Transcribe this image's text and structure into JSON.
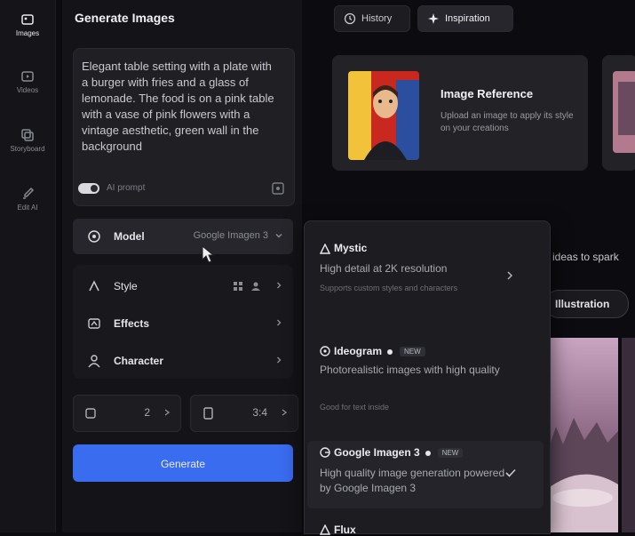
{
  "rail": {
    "items": [
      {
        "label": "Images",
        "icon": "image-icon",
        "active": true
      },
      {
        "label": "Videos",
        "icon": "video-icon"
      },
      {
        "label": "Storyboard",
        "icon": "storyboard-icon"
      },
      {
        "label": "Edit AI",
        "icon": "brush-icon"
      }
    ]
  },
  "panel": {
    "title": "Generate Images",
    "prompt": "Elegant table setting with a plate with a burger with fries and a glass of lemonade. The food is on a pink table with a vase of pink flowers with a vintage aesthetic, green wall in the background",
    "ai_prompt_label": "AI prompt",
    "model_row": {
      "label": "Model",
      "value": "Google Imagen 3"
    },
    "style_row": {
      "label": "Style"
    },
    "effects_row": {
      "label": "Effects"
    },
    "character_row": {
      "label": "Character"
    },
    "count_value": "2",
    "ratio_value": "3:4",
    "generate_label": "Generate"
  },
  "tabs": {
    "history": "History",
    "inspiration": "Inspiration"
  },
  "reference": {
    "title": "Image Reference",
    "description": "Upload an image to apply its style on your creations"
  },
  "partial": {
    "text": "ideas to spark",
    "pill": "Illustration"
  },
  "dropdown": {
    "options": [
      {
        "name": "Mystic",
        "description": "High detail at 2K resolution",
        "meta": "Supports custom styles and characters"
      },
      {
        "name": "Ideogram",
        "badge": "NEW",
        "description": "Photorealistic images with high quality",
        "meta": "Good for text inside"
      },
      {
        "name": "Google Imagen 3",
        "badge": "NEW",
        "description": "High quality image generation powered by Google Imagen 3",
        "selected": true
      },
      {
        "name": "Flux"
      }
    ]
  },
  "colors": {
    "accent": "#3a6cf0",
    "background": "#0c0c10",
    "panel": "#141418"
  }
}
